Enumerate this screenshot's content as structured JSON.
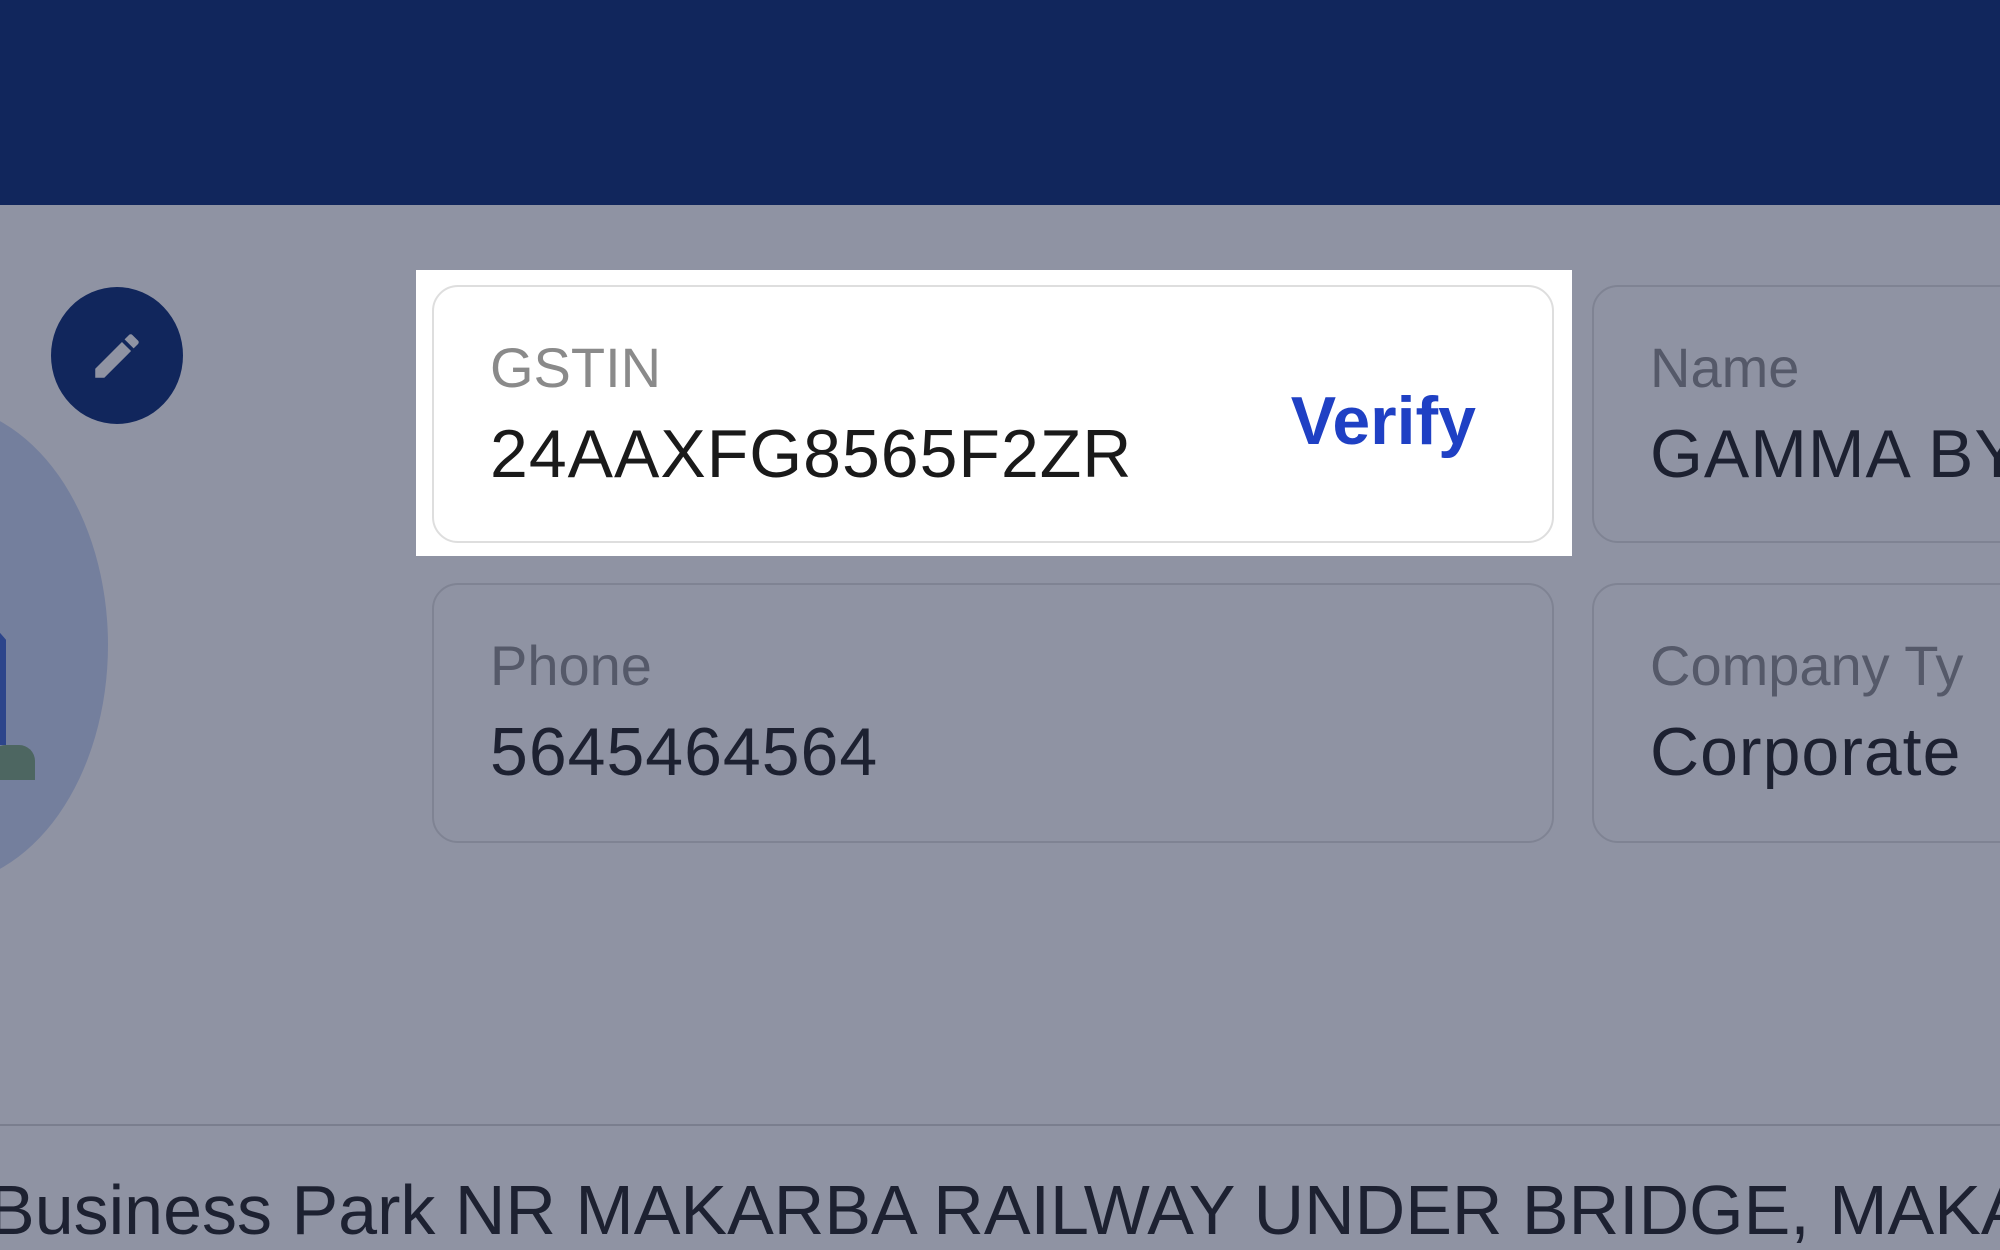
{
  "fields": {
    "gstin": {
      "label": "GSTIN",
      "value": "24AAXFG8565F2ZR",
      "action_label": "Verify"
    },
    "name": {
      "label": "Name",
      "value": "GAMMA BY"
    },
    "phone": {
      "label": "Phone",
      "value": "5645464564"
    },
    "company_type": {
      "label": "Company Ty",
      "value": "Corporate"
    }
  },
  "address": {
    "text": "Business Park NR MAKARBA RAILWAY UNDER BRIDGE, MAKA"
  },
  "icons": {
    "edit": "pencil-icon"
  },
  "colors": {
    "header": "#032570",
    "accent": "#1f40c4",
    "overlay": "rgba(32, 40, 72, 0.5)"
  }
}
